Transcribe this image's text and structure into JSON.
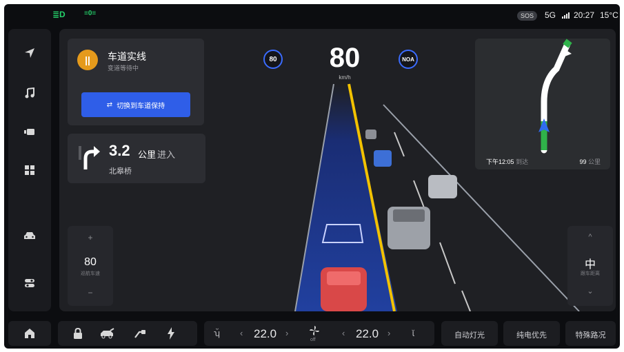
{
  "status": {
    "left_icons": [
      "high-beam-icon",
      "fog-light-icon"
    ],
    "sos": "SOS",
    "network": "5G",
    "time": "20:27",
    "temp": "15°C"
  },
  "lane_card": {
    "title": "车道实线",
    "subtitle": "变道等待中",
    "button": "切换到车道保持"
  },
  "nav_card": {
    "distance": "3.2",
    "unit": "公里",
    "action": "进入",
    "road": "北皋桥"
  },
  "speed": {
    "value": "80",
    "unit": "km/h",
    "limit_badge": "80",
    "noa_badge": "NOA"
  },
  "minimap": {
    "eta_label": "下午",
    "eta_time": "12:05",
    "eta_suffix": "到达",
    "distance": "99",
    "distance_unit": "公里"
  },
  "cruise": {
    "speed": "80",
    "label": "巡航车速",
    "plus": "+",
    "minus": "−"
  },
  "gap": {
    "value": "中",
    "label": "跟车距离",
    "up": "^",
    "down": "⌄"
  },
  "bottom": {
    "temp_left": "22.0",
    "temp_right": "22.0",
    "fan_label": "off",
    "quick_1": "自动灯光",
    "quick_2": "纯电优先",
    "quick_3": "特殊路况"
  },
  "colors": {
    "accent_blue": "#2f5ee8",
    "lane_blue": "#1e3a9c",
    "status_green": "#25d06a",
    "lane_yellow": "#f2c200",
    "orange": "#e59a1c"
  }
}
